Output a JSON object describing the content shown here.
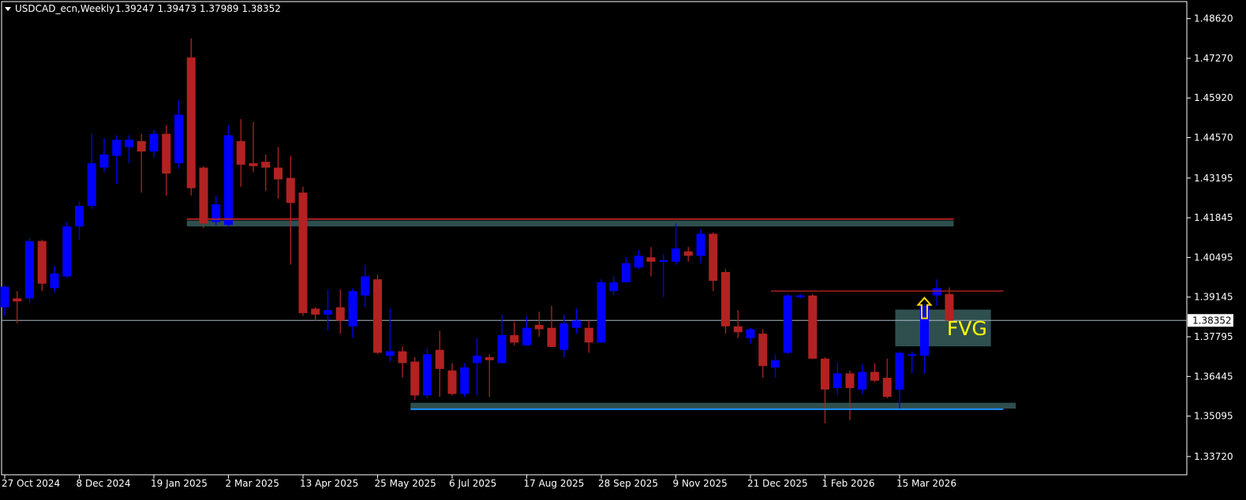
{
  "header": {
    "symbol_label": "USDCAD_ecn,Weekly",
    "ohlc_label": "1.39247 1.39473 1.37989 1.38352"
  },
  "colors": {
    "background": "#000000",
    "frame": "#ffffff",
    "bull": "#0000ff",
    "bear": "#b22222",
    "zone": "#2f4f4f",
    "resistance_line": "#b22222",
    "support_line": "#1e90ff",
    "price_line": "#a9b7c6",
    "fvg_text": "#ffff00",
    "arrow": "#ffd700",
    "price_tag_bg": "#ffffff"
  },
  "chart_data": {
    "type": "candlestick",
    "timeframe": "Weekly",
    "ylim": [
      1.331,
      1.492
    ],
    "y_ticks": [
      "1.48620",
      "1.47270",
      "1.45920",
      "1.44570",
      "1.43195",
      "1.41845",
      "1.40495",
      "1.39145",
      "1.37795",
      "1.36445",
      "1.35095",
      "1.33720"
    ],
    "x_tick_labels": [
      {
        "index": 0,
        "label": "27 Oct 2024"
      },
      {
        "index": 6,
        "label": "8 Dec 2024"
      },
      {
        "index": 12,
        "label": "19 Jan 2025"
      },
      {
        "index": 18,
        "label": "2 Mar 2025"
      },
      {
        "index": 24,
        "label": "13 Apr 2025"
      },
      {
        "index": 30,
        "label": "25 May 2025"
      },
      {
        "index": 36,
        "label": "6 Jul 2025"
      },
      {
        "index": 42,
        "label": "17 Aug 2025"
      },
      {
        "index": 48,
        "label": "28 Sep 2025"
      },
      {
        "index": 54,
        "label": "9 Nov 2025"
      },
      {
        "index": 60,
        "label": "21 Dec 2025"
      },
      {
        "index": 66,
        "label": "1 Feb 2026"
      },
      {
        "index": 72,
        "label": "15 Mar 2026"
      }
    ],
    "current_price": "1.38352",
    "candles": [
      {
        "o": 1.388,
        "h": 1.3955,
        "l": 1.385,
        "c": 1.395
      },
      {
        "o": 1.391,
        "h": 1.3935,
        "l": 1.3825,
        "c": 1.39
      },
      {
        "o": 1.391,
        "h": 1.4115,
        "l": 1.3895,
        "c": 1.4105
      },
      {
        "o": 1.4105,
        "h": 1.411,
        "l": 1.3935,
        "c": 1.396
      },
      {
        "o": 1.3945,
        "h": 1.402,
        "l": 1.393,
        "c": 1.3995
      },
      {
        "o": 1.3985,
        "h": 1.417,
        "l": 1.398,
        "c": 1.4155
      },
      {
        "o": 1.4155,
        "h": 1.424,
        "l": 1.411,
        "c": 1.4225
      },
      {
        "o": 1.4225,
        "h": 1.447,
        "l": 1.4215,
        "c": 1.437
      },
      {
        "o": 1.4355,
        "h": 1.4455,
        "l": 1.434,
        "c": 1.44
      },
      {
        "o": 1.4395,
        "h": 1.4465,
        "l": 1.43,
        "c": 1.445
      },
      {
        "o": 1.4425,
        "h": 1.4465,
        "l": 1.437,
        "c": 1.445
      },
      {
        "o": 1.4445,
        "h": 1.447,
        "l": 1.427,
        "c": 1.441
      },
      {
        "o": 1.441,
        "h": 1.4485,
        "l": 1.439,
        "c": 1.447
      },
      {
        "o": 1.447,
        "h": 1.45,
        "l": 1.426,
        "c": 1.4335
      },
      {
        "o": 1.437,
        "h": 1.4585,
        "l": 1.435,
        "c": 1.4535
      },
      {
        "o": 1.473,
        "h": 1.4795,
        "l": 1.426,
        "c": 1.4285
      },
      {
        "o": 1.4355,
        "h": 1.436,
        "l": 1.415,
        "c": 1.4165
      },
      {
        "o": 1.417,
        "h": 1.426,
        "l": 1.416,
        "c": 1.423
      },
      {
        "o": 1.416,
        "h": 1.45,
        "l": 1.4155,
        "c": 1.4465
      },
      {
        "o": 1.4445,
        "h": 1.452,
        "l": 1.429,
        "c": 1.4365
      },
      {
        "o": 1.437,
        "h": 1.451,
        "l": 1.434,
        "c": 1.436
      },
      {
        "o": 1.4375,
        "h": 1.44,
        "l": 1.4275,
        "c": 1.4355
      },
      {
        "o": 1.4355,
        "h": 1.4425,
        "l": 1.425,
        "c": 1.4315
      },
      {
        "o": 1.432,
        "h": 1.4395,
        "l": 1.4025,
        "c": 1.4235
      },
      {
        "o": 1.427,
        "h": 1.429,
        "l": 1.385,
        "c": 1.386
      },
      {
        "o": 1.3875,
        "h": 1.388,
        "l": 1.3835,
        "c": 1.3855
      },
      {
        "o": 1.3855,
        "h": 1.394,
        "l": 1.38,
        "c": 1.387
      },
      {
        "o": 1.388,
        "h": 1.394,
        "l": 1.379,
        "c": 1.3835
      },
      {
        "o": 1.3815,
        "h": 1.3945,
        "l": 1.3775,
        "c": 1.3935
      },
      {
        "o": 1.392,
        "h": 1.4025,
        "l": 1.388,
        "c": 1.3985
      },
      {
        "o": 1.3975,
        "h": 1.399,
        "l": 1.372,
        "c": 1.3725
      },
      {
        "o": 1.3715,
        "h": 1.3875,
        "l": 1.3695,
        "c": 1.373
      },
      {
        "o": 1.373,
        "h": 1.3745,
        "l": 1.364,
        "c": 1.369
      },
      {
        "o": 1.3695,
        "h": 1.371,
        "l": 1.3565,
        "c": 1.358
      },
      {
        "o": 1.358,
        "h": 1.374,
        "l": 1.357,
        "c": 1.372
      },
      {
        "o": 1.3735,
        "h": 1.38,
        "l": 1.3575,
        "c": 1.367
      },
      {
        "o": 1.3665,
        "h": 1.369,
        "l": 1.358,
        "c": 1.3585
      },
      {
        "o": 1.3585,
        "h": 1.369,
        "l": 1.3575,
        "c": 1.3675
      },
      {
        "o": 1.369,
        "h": 1.3775,
        "l": 1.358,
        "c": 1.3715
      },
      {
        "o": 1.371,
        "h": 1.372,
        "l": 1.3575,
        "c": 1.37
      },
      {
        "o": 1.369,
        "h": 1.3855,
        "l": 1.369,
        "c": 1.3785
      },
      {
        "o": 1.3785,
        "h": 1.383,
        "l": 1.375,
        "c": 1.376
      },
      {
        "o": 1.375,
        "h": 1.385,
        "l": 1.375,
        "c": 1.381
      },
      {
        "o": 1.382,
        "h": 1.3865,
        "l": 1.378,
        "c": 1.3805
      },
      {
        "o": 1.381,
        "h": 1.3885,
        "l": 1.3745,
        "c": 1.3745
      },
      {
        "o": 1.3735,
        "h": 1.3855,
        "l": 1.371,
        "c": 1.3825
      },
      {
        "o": 1.381,
        "h": 1.3875,
        "l": 1.379,
        "c": 1.3835
      },
      {
        "o": 1.381,
        "h": 1.3835,
        "l": 1.3725,
        "c": 1.376
      },
      {
        "o": 1.376,
        "h": 1.3975,
        "l": 1.376,
        "c": 1.3965
      },
      {
        "o": 1.3935,
        "h": 1.3985,
        "l": 1.392,
        "c": 1.3965
      },
      {
        "o": 1.3965,
        "h": 1.405,
        "l": 1.3965,
        "c": 1.403
      },
      {
        "o": 1.4015,
        "h": 1.4075,
        "l": 1.401,
        "c": 1.4055
      },
      {
        "o": 1.405,
        "h": 1.4085,
        "l": 1.3985,
        "c": 1.4035
      },
      {
        "o": 1.404,
        "h": 1.406,
        "l": 1.3915,
        "c": 1.404
      },
      {
        "o": 1.4035,
        "h": 1.4165,
        "l": 1.4025,
        "c": 1.408
      },
      {
        "o": 1.407,
        "h": 1.4085,
        "l": 1.4035,
        "c": 1.4055
      },
      {
        "o": 1.4055,
        "h": 1.4145,
        "l": 1.403,
        "c": 1.413
      },
      {
        "o": 1.413,
        "h": 1.4135,
        "l": 1.3935,
        "c": 1.397
      },
      {
        "o": 1.4,
        "h": 1.401,
        "l": 1.379,
        "c": 1.3815
      },
      {
        "o": 1.3815,
        "h": 1.387,
        "l": 1.3775,
        "c": 1.3795
      },
      {
        "o": 1.3775,
        "h": 1.381,
        "l": 1.3755,
        "c": 1.3805
      },
      {
        "o": 1.379,
        "h": 1.3805,
        "l": 1.364,
        "c": 1.368
      },
      {
        "o": 1.3675,
        "h": 1.372,
        "l": 1.364,
        "c": 1.37
      },
      {
        "o": 1.3725,
        "h": 1.3925,
        "l": 1.372,
        "c": 1.392
      },
      {
        "o": 1.3915,
        "h": 1.3925,
        "l": 1.391,
        "c": 1.392
      },
      {
        "o": 1.392,
        "h": 1.3925,
        "l": 1.3705,
        "c": 1.3705
      },
      {
        "o": 1.3705,
        "h": 1.371,
        "l": 1.3485,
        "c": 1.36
      },
      {
        "o": 1.3605,
        "h": 1.369,
        "l": 1.358,
        "c": 1.3655
      },
      {
        "o": 1.3655,
        "h": 1.3665,
        "l": 1.3495,
        "c": 1.3605
      },
      {
        "o": 1.36,
        "h": 1.3685,
        "l": 1.3585,
        "c": 1.366
      },
      {
        "o": 1.366,
        "h": 1.369,
        "l": 1.3625,
        "c": 1.363
      },
      {
        "o": 1.364,
        "h": 1.3705,
        "l": 1.357,
        "c": 1.3575
      },
      {
        "o": 1.36,
        "h": 1.373,
        "l": 1.3535,
        "c": 1.3725
      },
      {
        "o": 1.372,
        "h": 1.373,
        "l": 1.3655,
        "c": 1.372
      },
      {
        "o": 1.3715,
        "h": 1.389,
        "l": 1.3655,
        "c": 1.3885
      },
      {
        "o": 1.392,
        "h": 1.3975,
        "l": 1.3885,
        "c": 1.3945
      },
      {
        "o": 1.3925,
        "h": 1.3947,
        "l": 1.3799,
        "c": 1.3835
      }
    ],
    "annotations": [
      {
        "type": "zone",
        "name": "resistance-zone",
        "start_index": 15,
        "end_index": 76,
        "y1": 1.4155,
        "y2": 1.4175
      },
      {
        "type": "hline",
        "name": "resistance-line",
        "start_index": 15,
        "end_index": 76,
        "y": 1.418
      },
      {
        "type": "zone",
        "name": "support-zone",
        "start_index": 33,
        "end_index": 81,
        "y1": 1.3535,
        "y2": 1.3555
      },
      {
        "type": "hline",
        "name": "support-line",
        "start_index": 33,
        "end_index": 80,
        "y": 1.3533
      },
      {
        "type": "zone",
        "name": "fvg-zone",
        "start_index": 72,
        "end_index": 79,
        "y1": 1.3747,
        "y2": 1.3872,
        "label": "FVG"
      },
      {
        "type": "hline",
        "name": "top-line",
        "start_index": 62,
        "end_index": 80,
        "y": 1.3935
      },
      {
        "type": "arrow",
        "name": "up-arrow",
        "index": 74,
        "y": 1.388
      }
    ]
  }
}
